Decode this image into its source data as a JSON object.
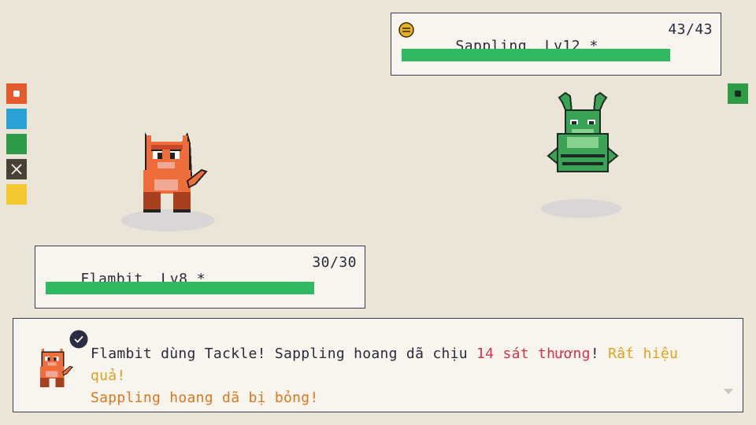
{
  "enemy": {
    "name": "Sappling",
    "level": "Lv12",
    "star": "*",
    "hp_text": "43/43",
    "hp_fraction": 1.0,
    "hp_color": "#2fba62",
    "badge_icon": "face-badge-icon"
  },
  "player": {
    "name": "Flambit",
    "level": "Lv8",
    "star": "*",
    "hp_text": "30/30",
    "hp_fraction": 1.0,
    "hp_color": "#2fba62"
  },
  "palette": {
    "swatches": [
      "#e55b2d",
      "#2ba2d6",
      "#2e9b46",
      "#4a4036",
      "#f2c72f"
    ],
    "enemy_marker_color": "#2e9b46"
  },
  "message": {
    "part1": "Flambit dùng Tackle! Sappling hoang dã chịu ",
    "damage": "14 sát thương",
    "part2": "! ",
    "effective": "Rất hiệu quả!",
    "line2": "Sappling hoang dã bị bỏng!",
    "damage_color": "#d8324a",
    "effective_color": "#e0a21c",
    "line2_color": "#e0771c"
  }
}
